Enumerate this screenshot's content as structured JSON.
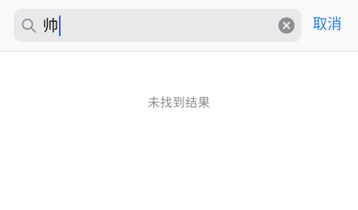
{
  "search": {
    "query": "帅",
    "icon": "search-icon",
    "clear_icon": "clear-icon"
  },
  "header": {
    "cancel_label": "取消"
  },
  "results": {
    "empty_message": "未找到结果"
  },
  "colors": {
    "accent": "#2f7de1",
    "caret": "#3b5de0",
    "search_background": "#e9e9eb",
    "empty_text": "#8b8b8b"
  }
}
